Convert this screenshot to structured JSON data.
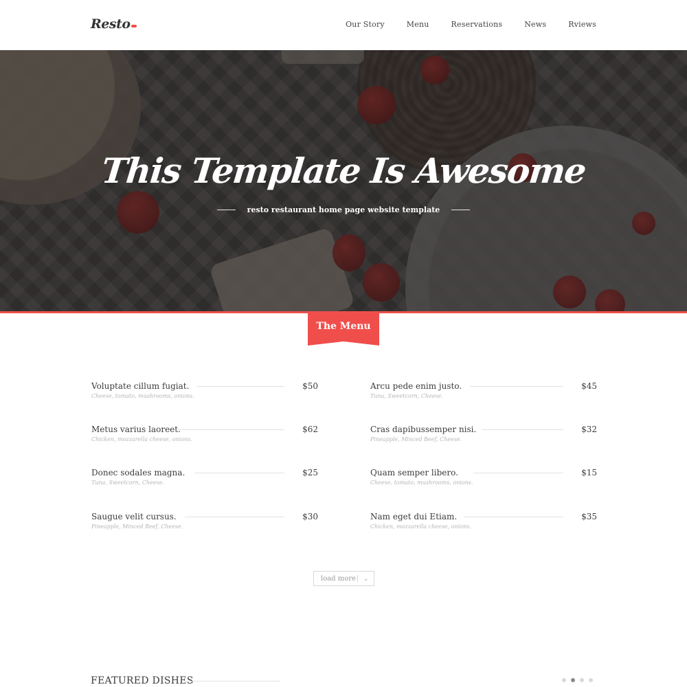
{
  "header": {
    "logo": "Resto",
    "nav": [
      "Our Story",
      "Menu",
      "Reservations",
      "News",
      "Rviews"
    ]
  },
  "hero": {
    "title": "This Template Is Awesome",
    "subtitle": "resto restaurant home page website template"
  },
  "menu_section": {
    "ribbon_label": "The Menu",
    "items": [
      {
        "name": "Voluptate cillum fugiat.",
        "desc": "Cheese, tomato, mushrooms, onions.",
        "price": "$50"
      },
      {
        "name": "Arcu pede enim justo.",
        "desc": "Tuna, Sweetcorn, Cheese.",
        "price": "$45"
      },
      {
        "name": "Metus varius laoreet.",
        "desc": "Chicken, mozzarella cheese, onions.",
        "price": "$62"
      },
      {
        "name": "Cras dapibussemper nisi.",
        "desc": "Pineapple, Minced Beef, Cheese.",
        "price": "$32"
      },
      {
        "name": "Donec sodales magna.",
        "desc": "Tuna, Sweetcorn, Cheese.",
        "price": "$25"
      },
      {
        "name": "Quam semper libero.",
        "desc": "Cheese, tomato, mushrooms, onions.",
        "price": "$15"
      },
      {
        "name": "Saugue velit cursus.",
        "desc": "Pineapple, Minced Beef, Cheese.",
        "price": "$30"
      },
      {
        "name": "Nam eget dui Etiam.",
        "desc": "Chicken, mozzarella cheese, onions.",
        "price": "$35"
      }
    ],
    "load_more": "load more",
    "load_more_icon": "chevron-down-icon"
  },
  "featured": {
    "title": "FEATURED DISHES",
    "carousel_pages": 4,
    "active_page": 2
  },
  "colors": {
    "accent": "#f04e4b",
    "text": "#3b3b3b",
    "muted": "#b5b5b5"
  }
}
